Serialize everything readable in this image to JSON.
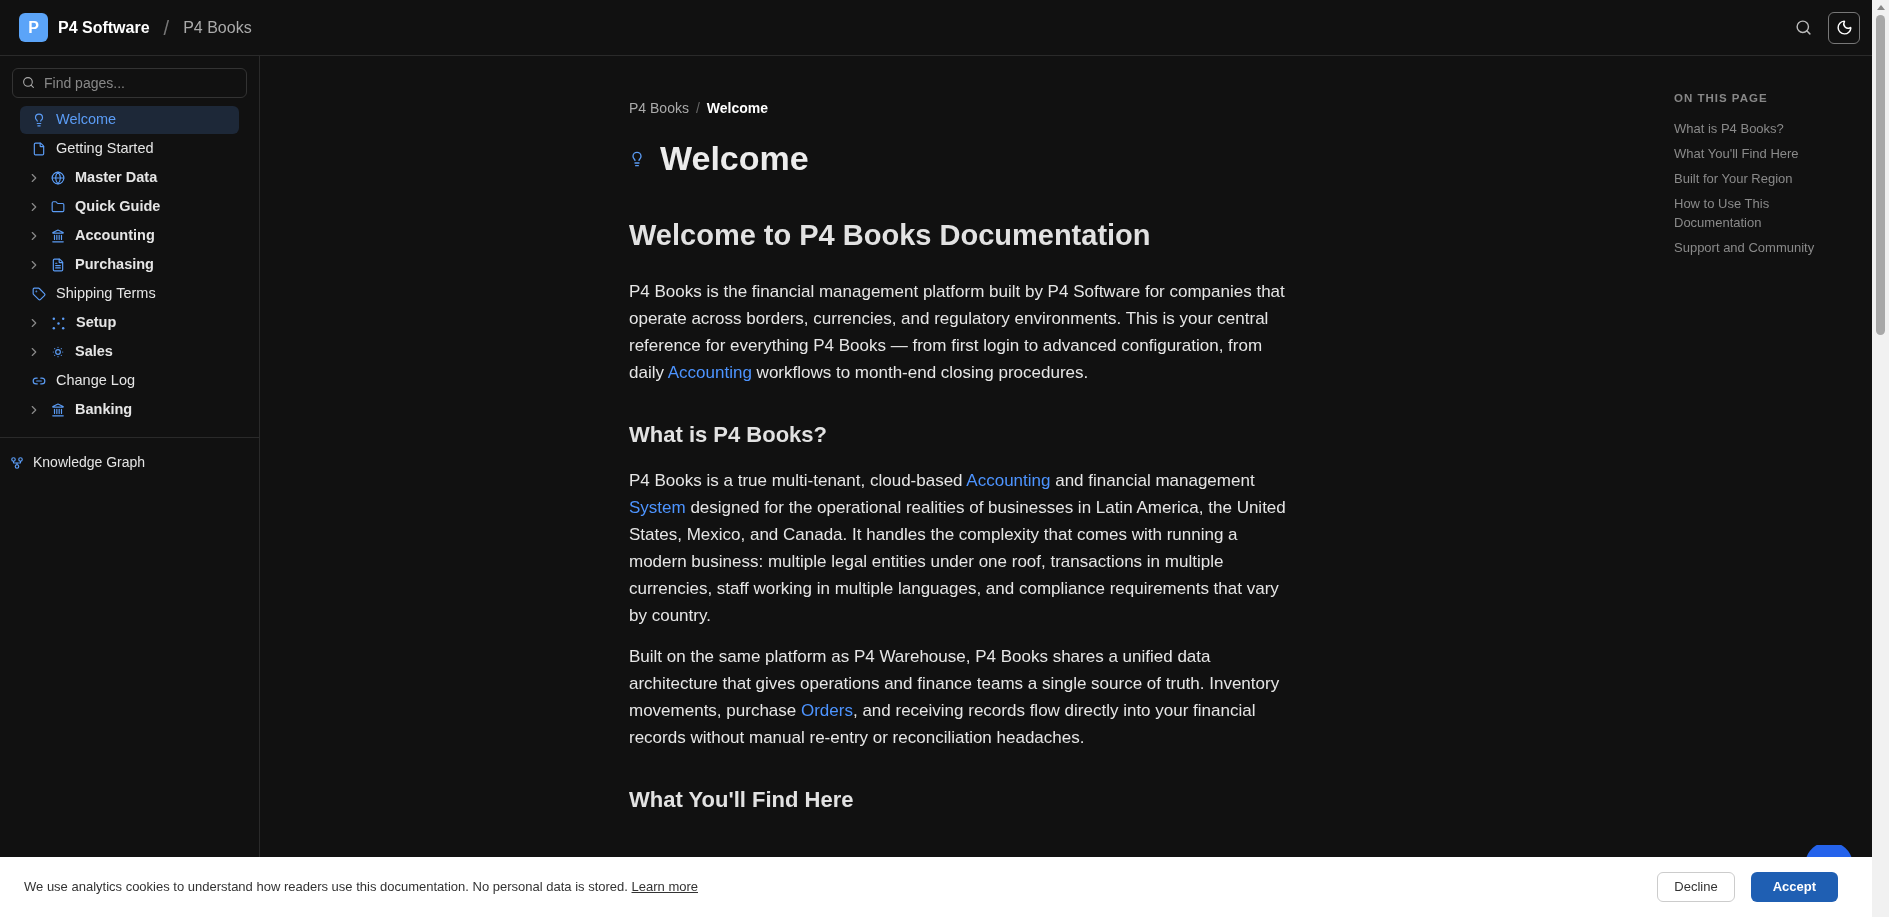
{
  "header": {
    "logo_letter": "P",
    "brand": "P4 Software",
    "separator": "/",
    "product": "P4 Books"
  },
  "sidebar": {
    "search": {
      "placeholder": "Find pages..."
    },
    "items": [
      {
        "label": "Welcome",
        "kind": "page",
        "selected": true
      },
      {
        "label": "Getting Started",
        "kind": "page",
        "selected": false
      },
      {
        "label": "Master Data",
        "kind": "section",
        "selected": false
      },
      {
        "label": "Quick Guide",
        "kind": "section",
        "selected": false
      },
      {
        "label": "Accounting",
        "kind": "section",
        "selected": false
      },
      {
        "label": "Purchasing",
        "kind": "section",
        "selected": false
      },
      {
        "label": "Shipping Terms",
        "kind": "page",
        "selected": false
      },
      {
        "label": "Setup",
        "kind": "section",
        "selected": false
      },
      {
        "label": "Sales",
        "kind": "section",
        "selected": false
      },
      {
        "label": "Change Log",
        "kind": "page",
        "selected": false
      },
      {
        "label": "Banking",
        "kind": "section",
        "selected": false
      }
    ],
    "footer_link": "Knowledge Graph"
  },
  "breadcrumb": {
    "separator": "/",
    "items": [
      {
        "label": "P4 Books",
        "current": false
      },
      {
        "label": "Welcome",
        "current": true
      }
    ]
  },
  "title": "Welcome",
  "content": [
    {
      "kind": "h2",
      "text": "Welcome to P4 Books Documentation"
    },
    {
      "kind": "p",
      "parts": [
        {
          "text": "P4 Books is the financial management platform built by P4 Software for companies that operate across borders, currencies, and regulatory environments. This is your central reference for everything P4 Books — from first login to advanced configuration, from daily ",
          "link": false
        },
        {
          "text": "Accounting",
          "link": true
        },
        {
          "text": " workflows to month-end closing procedures.",
          "link": false
        }
      ]
    },
    {
      "kind": "h3",
      "text": "What is P4 Books?"
    },
    {
      "kind": "p",
      "parts": [
        {
          "text": "P4 Books is a true multi-tenant, cloud-based ",
          "link": false
        },
        {
          "text": "Accounting",
          "link": true
        },
        {
          "text": " and financial management ",
          "link": false
        },
        {
          "text": "System",
          "link": true
        },
        {
          "text": " designed for the operational realities of businesses in Latin America, the United States, Mexico, and Canada. It handles the complexity that comes with running a modern business: multiple legal entities under one roof, transactions in multiple currencies, staff working in multiple languages, and compliance requirements that vary by country.",
          "link": false
        }
      ]
    },
    {
      "kind": "p",
      "parts": [
        {
          "text": "Built on the same platform as P4 Warehouse, P4 Books shares a unified data architecture that gives operations and finance teams a single source of truth. Inventory movements, purchase ",
          "link": false
        },
        {
          "text": "Orders",
          "link": true
        },
        {
          "text": ", and receiving records flow directly into your financial records without manual re-entry or reconciliation headaches.",
          "link": false
        }
      ]
    },
    {
      "kind": "h3",
      "text": "What You'll Find Here"
    }
  ],
  "toc": {
    "heading": "ON THIS PAGE",
    "items": [
      "What is P4 Books?",
      "What You'll Find Here",
      "Built for Your Region",
      "How to Use This Documentation",
      "Support and Community"
    ]
  },
  "cookie_bar": {
    "message": "We use analytics cookies to understand how readers use this documentation. No personal data is stored.",
    "link": "Learn more",
    "decline": "Decline",
    "accept": "Accept"
  }
}
